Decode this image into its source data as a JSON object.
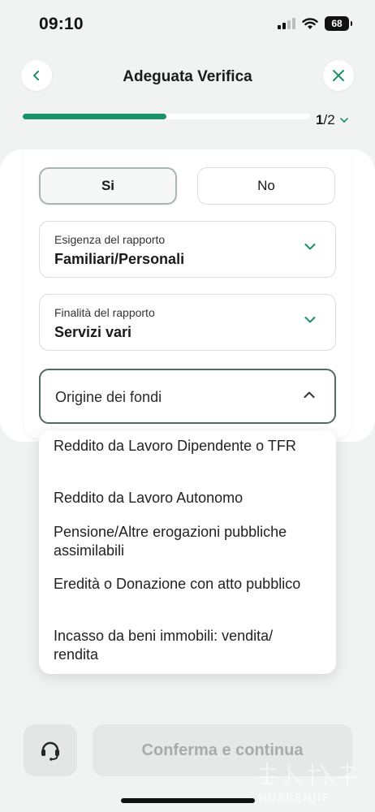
{
  "status_bar": {
    "time": "09:10",
    "battery": "68"
  },
  "header": {
    "title": "Adeguata Verifica",
    "back_icon": "chevron-left-icon",
    "close_icon": "close-icon"
  },
  "progress": {
    "fraction": 0.5,
    "current": "1",
    "total": "/2"
  },
  "toggle": {
    "yes_label": "Si",
    "no_label": "No",
    "selected": "Si"
  },
  "fields": {
    "esigenza": {
      "label": "Esigenza del rapporto",
      "value": "Familiari/Personali"
    },
    "finalita": {
      "label": "Finalità del rapporto",
      "value": "Servizi vari"
    },
    "origine": {
      "placeholder": "Origine dei fondi"
    }
  },
  "dropdown": {
    "options": [
      "Reddito da Lavoro Dipendente o TFR",
      "Reddito da Lavoro Autonomo",
      "Pensione/Altre erogazioni pubbliche assimilabili",
      "Eredità o Donazione con atto pubblico",
      "Incasso da beni immobili: vendita/ rendita"
    ]
  },
  "footer": {
    "confirm_label": "Conferma e continua",
    "help_icon": "headset-icon"
  },
  "colors": {
    "accent": "#1a9166",
    "disabled_text": "#a7acaa"
  }
}
